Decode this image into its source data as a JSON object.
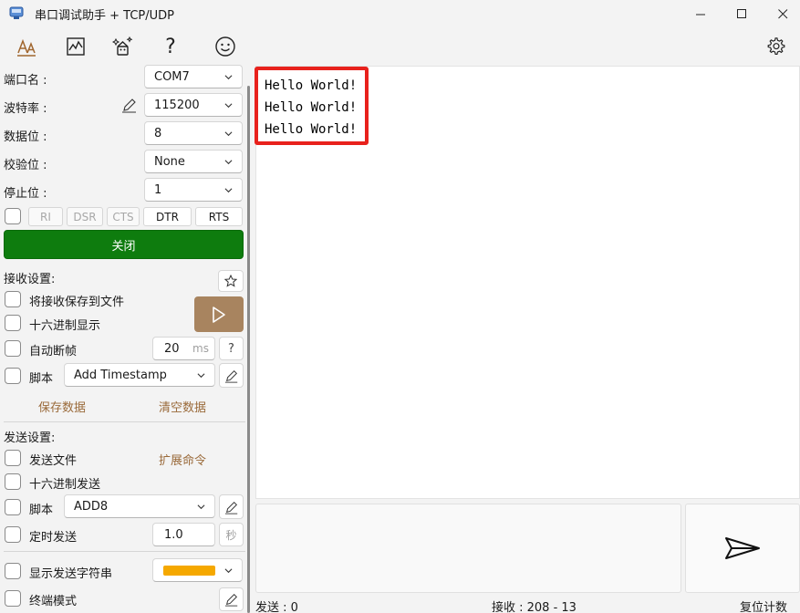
{
  "window": {
    "title": "串口调试助手 + TCP/UDP",
    "minimize": "—",
    "maximize": "☐",
    "close": "✕"
  },
  "toolbar": {
    "icons": [
      "font-icon",
      "chart-icon",
      "magic-icon",
      "help-icon",
      "smiley-icon",
      "settings-icon"
    ],
    "help_glyph": "?"
  },
  "serial": {
    "port_label": "端口名 :",
    "port_value": "COM7",
    "baud_label": "波特率 :",
    "baud_value": "115200",
    "databits_label": "数据位 :",
    "databits_value": "8",
    "parity_label": "校验位 :",
    "parity_value": "None",
    "stopbits_label": "停止位 :",
    "stopbits_value": "1",
    "signals": [
      "RI",
      "DSR",
      "CTS",
      "DTR",
      "RTS"
    ],
    "close_button": "关闭"
  },
  "receive": {
    "section_label": "接收设置:",
    "save_to_file": "将接收保存到文件",
    "hex_display": "十六进制显示",
    "auto_frame": "自动断帧",
    "frame_ms_value": "20",
    "frame_unit": "ms",
    "frame_help": "?",
    "script_label": "脚本",
    "script_value": "Add Timestamp",
    "save_data": "保存数据",
    "clear_data": "清空数据",
    "lines": [
      "Hello World!",
      "Hello World!",
      "Hello World!"
    ]
  },
  "send": {
    "section_label": "发送设置:",
    "send_file": "发送文件",
    "ext_commands": "扩展命令",
    "hex_send": "十六进制发送",
    "script_label": "脚本",
    "script_value": "ADD8",
    "timed_send": "定时发送",
    "timed_value": "1.0",
    "timed_unit": "秒",
    "show_string": "显示发送字符串",
    "terminal_mode": "终端模式",
    "highlight_color": "#f5a800"
  },
  "status": {
    "sent": "发送 : 0",
    "received": "接收 : 208 - 13",
    "reset": "复位计数"
  },
  "colors": {
    "close_button": "#0e7c0e",
    "play_button": "#a8845f",
    "highlight_box": "#e8211c",
    "link": "#9a6a3a"
  }
}
